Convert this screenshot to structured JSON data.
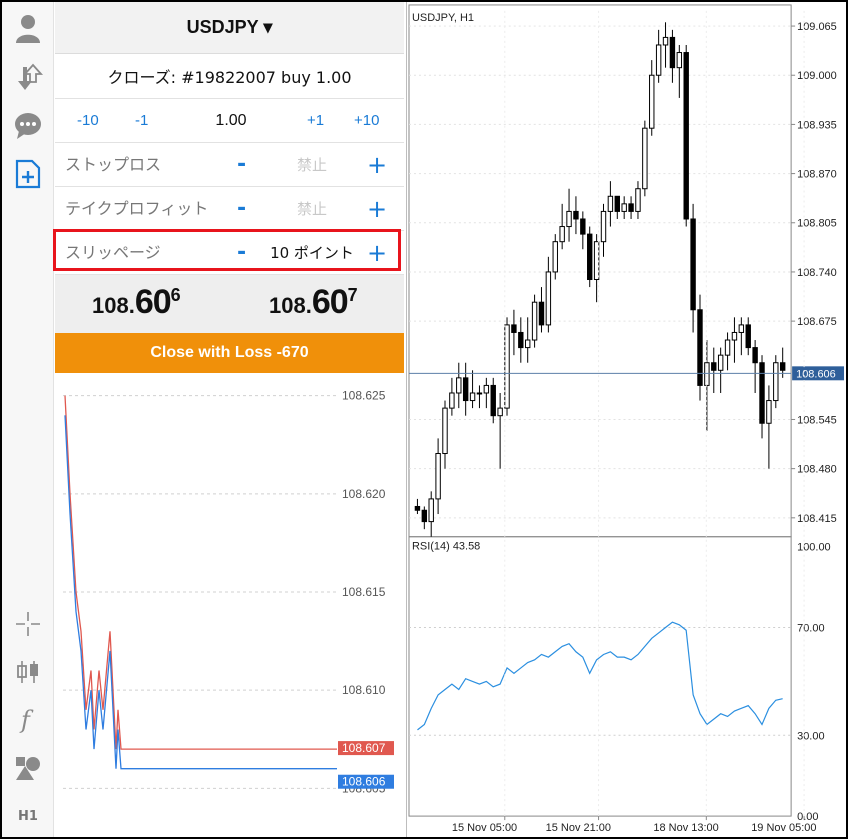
{
  "sidebar": {
    "icons": [
      "account-icon",
      "trade-transfer-icon",
      "chat-icon",
      "new-order-icon",
      "crosshair-icon",
      "candles-icon",
      "function-icon",
      "objects-icon"
    ],
    "timeframe_label": "H1"
  },
  "order": {
    "symbol": "USDJPY ▾",
    "close_line": "クローズ: #19822007 buy 1.00",
    "volume": {
      "minus10": "-10",
      "minus1": "-1",
      "value": "1.00",
      "plus1": "+1",
      "plus10": "+10"
    },
    "stop_loss": {
      "label": "ストップロス",
      "minus": "-",
      "value": "禁止",
      "plus": "+"
    },
    "take_profit": {
      "label": "テイクプロフィット",
      "minus": "-",
      "value": "禁止",
      "plus": "+"
    },
    "slippage": {
      "label": "スリッページ",
      "minus": "-",
      "value": "10 ポイント",
      "plus": "+"
    },
    "bid": {
      "prefix": "108.",
      "big": "60",
      "sup": "6"
    },
    "ask": {
      "prefix": "108.",
      "big": "60",
      "sup": "7"
    },
    "close_button": "Close with Loss -670"
  },
  "tick_chart": {
    "y_ticks": [
      "108.625",
      "108.620",
      "108.615",
      "108.610",
      "108.605"
    ],
    "ask_label": "108.607",
    "bid_label": "108.606",
    "ask_color": "#e0584f",
    "bid_color": "#2f7de0"
  },
  "main_chart": {
    "title": "USDJPY, H1",
    "price_ticks": [
      "109.065",
      "109.000",
      "108.935",
      "108.870",
      "108.805",
      "108.740",
      "108.675",
      "108.606",
      "108.545",
      "108.480",
      "108.415"
    ],
    "current_price": "108.606",
    "rsi_title": "RSI(14) 43.58",
    "rsi_ticks": [
      "100.00",
      "70.00",
      "30.00",
      "0.00"
    ],
    "time_labels": [
      "15 Nov 05:00",
      "15 Nov 21:00",
      "18 Nov 13:00",
      "19 Nov 05:00"
    ],
    "rsi_color": "#2b8fe0",
    "price_line_color": "#5b7fa8"
  },
  "chart_data": [
    {
      "type": "line",
      "title": "",
      "y_ticks": [
        108.625,
        108.62,
        108.615,
        108.61,
        108.605
      ],
      "ylim": [
        108.604,
        108.626
      ],
      "series": [
        {
          "name": "",
          "values": [
            108.625,
            108.62,
            108.615,
            108.613,
            108.609,
            108.611,
            108.608,
            108.611,
            108.609,
            108.613,
            108.607,
            108.609,
            108.607,
            108.607,
            108.607
          ]
        },
        {
          "name": "",
          "values": [
            108.624,
            108.619,
            108.614,
            108.612,
            108.608,
            108.61,
            108.607,
            108.61,
            108.608,
            108.612,
            108.606,
            108.608,
            108.606,
            108.606,
            108.606
          ]
        }
      ]
    },
    {
      "type": "candlestick",
      "title": "USDJPY, H1",
      "ylim": [
        108.39,
        109.085
      ],
      "x_labels": [
        "15 Nov 05:00",
        "15 Nov 21:00",
        "18 Nov 13:00",
        "19 Nov 05:00"
      ],
      "ohlc": [
        [
          108.43,
          108.44,
          108.42,
          108.425
        ],
        [
          108.425,
          108.43,
          108.4,
          108.41
        ],
        [
          108.41,
          108.45,
          108.39,
          108.44
        ],
        [
          108.44,
          108.52,
          108.42,
          108.5
        ],
        [
          108.5,
          108.57,
          108.48,
          108.56
        ],
        [
          108.56,
          108.6,
          108.55,
          108.58
        ],
        [
          108.58,
          108.62,
          108.56,
          108.6
        ],
        [
          108.6,
          108.62,
          108.55,
          108.57
        ],
        [
          108.57,
          108.61,
          108.56,
          108.58
        ],
        [
          108.58,
          108.59,
          108.56,
          108.58
        ],
        [
          108.58,
          108.6,
          108.56,
          108.59
        ],
        [
          108.59,
          108.6,
          108.54,
          108.55
        ],
        [
          108.55,
          108.58,
          108.48,
          108.56
        ],
        [
          108.56,
          108.68,
          108.55,
          108.67
        ],
        [
          108.67,
          108.69,
          108.63,
          108.66
        ],
        [
          108.66,
          108.68,
          108.62,
          108.64
        ],
        [
          108.64,
          108.68,
          108.62,
          108.65
        ],
        [
          108.65,
          108.71,
          108.64,
          108.7
        ],
        [
          108.7,
          108.72,
          108.66,
          108.67
        ],
        [
          108.67,
          108.76,
          108.66,
          108.74
        ],
        [
          108.74,
          108.79,
          108.73,
          108.78
        ],
        [
          108.78,
          108.83,
          108.77,
          108.8
        ],
        [
          108.8,
          108.85,
          108.78,
          108.82
        ],
        [
          108.82,
          108.84,
          108.79,
          108.81
        ],
        [
          108.81,
          108.82,
          108.77,
          108.79
        ],
        [
          108.79,
          108.8,
          108.72,
          108.73
        ],
        [
          108.73,
          108.79,
          108.7,
          108.78
        ],
        [
          108.78,
          108.83,
          108.76,
          108.82
        ],
        [
          108.82,
          108.86,
          108.8,
          108.84
        ],
        [
          108.84,
          108.84,
          108.81,
          108.82
        ],
        [
          108.82,
          108.84,
          108.81,
          108.83
        ],
        [
          108.83,
          108.84,
          108.81,
          108.82
        ],
        [
          108.82,
          108.86,
          108.81,
          108.85
        ],
        [
          108.85,
          108.94,
          108.84,
          108.93
        ],
        [
          108.93,
          109.02,
          108.92,
          109.0
        ],
        [
          109.0,
          109.06,
          108.99,
          109.04
        ],
        [
          109.04,
          109.07,
          109.01,
          109.05
        ],
        [
          109.05,
          109.06,
          108.99,
          109.01
        ],
        [
          109.01,
          109.04,
          108.97,
          109.03
        ],
        [
          109.03,
          109.04,
          108.8,
          108.81
        ],
        [
          108.81,
          108.83,
          108.66,
          108.69
        ],
        [
          108.69,
          108.71,
          108.57,
          108.59
        ],
        [
          108.59,
          108.65,
          108.53,
          108.62
        ],
        [
          108.62,
          108.64,
          108.58,
          108.61
        ],
        [
          108.61,
          108.64,
          108.58,
          108.63
        ],
        [
          108.63,
          108.66,
          108.61,
          108.65
        ],
        [
          108.65,
          108.68,
          108.62,
          108.66
        ],
        [
          108.66,
          108.68,
          108.63,
          108.67
        ],
        [
          108.67,
          108.68,
          108.63,
          108.64
        ],
        [
          108.64,
          108.65,
          108.58,
          108.62
        ],
        [
          108.62,
          108.63,
          108.52,
          108.54
        ],
        [
          108.54,
          108.59,
          108.48,
          108.57
        ],
        [
          108.57,
          108.63,
          108.56,
          108.62
        ],
        [
          108.62,
          108.64,
          108.6,
          108.61
        ]
      ]
    },
    {
      "type": "line",
      "title": "RSI(14) 43.58",
      "ylim": [
        0,
        100
      ],
      "y_ticks": [
        100,
        70,
        30,
        0
      ],
      "series": [
        {
          "name": "",
          "values": [
            32,
            34,
            40,
            45,
            47,
            49,
            47,
            51,
            50,
            49,
            50,
            48,
            49,
            55,
            53,
            55,
            57,
            58,
            60,
            59,
            61,
            63,
            64,
            61,
            59,
            53,
            58,
            60,
            61,
            59,
            59,
            58,
            60,
            63,
            66,
            68,
            70,
            72,
            71,
            69,
            45,
            38,
            34,
            36,
            38,
            37,
            39,
            40,
            41,
            38,
            34,
            40,
            43,
            43.58
          ]
        }
      ]
    }
  ]
}
